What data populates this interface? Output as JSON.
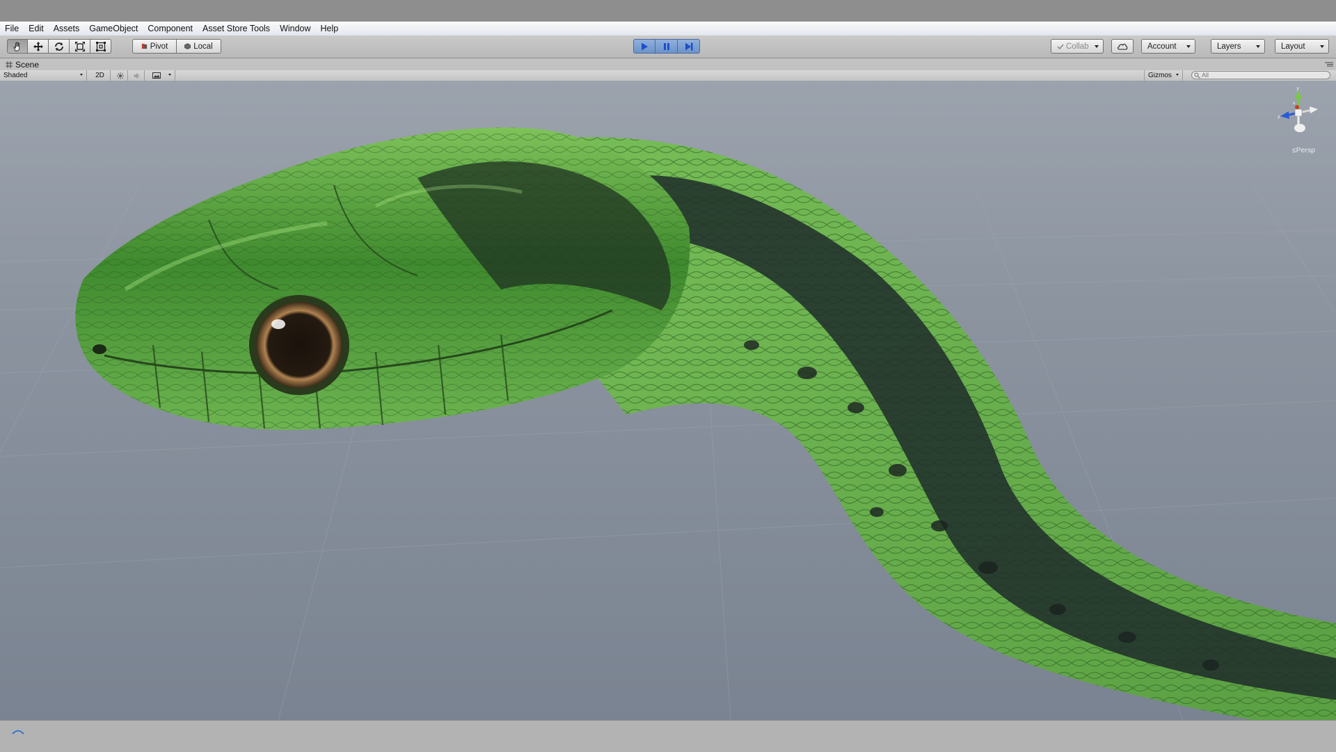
{
  "menubar": {
    "items": [
      "File",
      "Edit",
      "Assets",
      "GameObject",
      "Component",
      "Asset Store Tools",
      "Window",
      "Help"
    ]
  },
  "toolbar": {
    "transform_tools": [
      "hand-icon",
      "move-icon",
      "rotate-icon",
      "scale-icon",
      "rect-tool-icon"
    ],
    "pivot_label": "Pivot",
    "local_label": "Local",
    "playback": [
      "play-icon",
      "pause-icon",
      "step-icon"
    ],
    "collab_label": "Collab",
    "account_label": "Account",
    "layers_label": "Layers",
    "layout_label": "Layout"
  },
  "scene": {
    "tab_label": "Scene",
    "draw_mode": "Shaded",
    "mode_2d": "2D",
    "gizmos_label": "Gizmos",
    "search_placeholder": "All",
    "projection_label": "Persp",
    "axis_labels": {
      "y": "y",
      "x": "x",
      "z": "z"
    }
  },
  "colors": {
    "play_accent": "#6d93c8",
    "viewport_bg": "#8e96a2",
    "snake_green": "#5fae45",
    "snake_dark": "#1e2a28"
  }
}
